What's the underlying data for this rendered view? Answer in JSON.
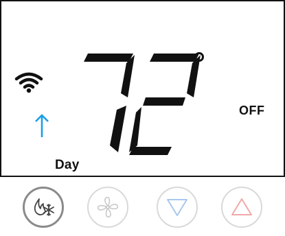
{
  "display": {
    "temperature": "72",
    "temperature_unit_symbol": "°",
    "system_mode": "OFF",
    "schedule_period": "Day",
    "temp_trend": "up",
    "wifi_connected": true
  },
  "icons": {
    "wifi": "wifi-icon",
    "trend": "arrow-up-icon",
    "mode": "flame-snowflake-icon",
    "fan": "fan-icon",
    "down": "triangle-down-icon",
    "up": "triangle-up-icon"
  },
  "colors": {
    "display_text": "#111111",
    "trend_arrow": "#1a9ee6",
    "down_button": "#a7c8ef",
    "up_button": "#efa9a9",
    "fan_button": "#c9c9c9",
    "mode_button": "#555555"
  }
}
